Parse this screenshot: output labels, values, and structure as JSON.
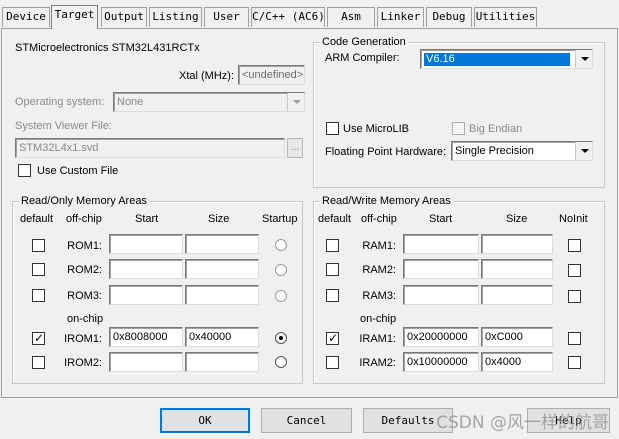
{
  "tabs": [
    {
      "label": "Device",
      "active": false
    },
    {
      "label": "Target",
      "active": true
    },
    {
      "label": "Output",
      "active": false
    },
    {
      "label": "Listing",
      "active": false
    },
    {
      "label": "User",
      "active": false
    },
    {
      "label": "C/C++ (AC6)",
      "active": false
    },
    {
      "label": "Asm",
      "active": false
    },
    {
      "label": "Linker",
      "active": false
    },
    {
      "label": "Debug",
      "active": false
    },
    {
      "label": "Utilities",
      "active": false
    }
  ],
  "device": {
    "name": "STMicroelectronics STM32L431RCTx",
    "xtal_label": "Xtal (MHz):",
    "xtal_value": "<undefined>",
    "os_label": "Operating system:",
    "os_value": "None",
    "svd_label": "System Viewer File:",
    "svd_value": "STM32L4x1.svd",
    "browse_label": "...",
    "custom_file_label": "Use Custom File",
    "custom_file_checked": false
  },
  "codegen": {
    "title": "Code Generation",
    "compiler_label": "ARM Compiler:",
    "compiler_value": "V6.16",
    "microlib_label": "Use MicroLIB",
    "microlib_checked": false,
    "big_endian_label": "Big Endian",
    "big_endian_checked": false,
    "fph_label": "Floating Point Hardware:",
    "fph_value": "Single Precision"
  },
  "ro_memory": {
    "title": "Read/Only Memory Areas",
    "headers": {
      "default": "default",
      "offchip": "off-chip",
      "start": "Start",
      "size": "Size",
      "startup": "Startup"
    },
    "onchip_label": "on-chip",
    "rows": [
      {
        "name": "ROM1:",
        "default": false,
        "start": "",
        "size": "",
        "startup": false,
        "enabled": false
      },
      {
        "name": "ROM2:",
        "default": false,
        "start": "",
        "size": "",
        "startup": false,
        "enabled": false
      },
      {
        "name": "ROM3:",
        "default": false,
        "start": "",
        "size": "",
        "startup": false,
        "enabled": false
      },
      {
        "name": "IROM1:",
        "default": true,
        "start": "0x8008000",
        "size": "0x40000",
        "startup": true,
        "enabled": true
      },
      {
        "name": "IROM2:",
        "default": false,
        "start": "",
        "size": "",
        "startup": false,
        "enabled": true
      }
    ]
  },
  "rw_memory": {
    "title": "Read/Write Memory Areas",
    "headers": {
      "default": "default",
      "offchip": "off-chip",
      "start": "Start",
      "size": "Size",
      "noinit": "NoInit"
    },
    "onchip_label": "on-chip",
    "rows": [
      {
        "name": "RAM1:",
        "default": false,
        "start": "",
        "size": "",
        "noinit": false
      },
      {
        "name": "RAM2:",
        "default": false,
        "start": "",
        "size": "",
        "noinit": false
      },
      {
        "name": "RAM3:",
        "default": false,
        "start": "",
        "size": "",
        "noinit": false
      },
      {
        "name": "IRAM1:",
        "default": true,
        "start": "0x20000000",
        "size": "0xC000",
        "noinit": false
      },
      {
        "name": "IRAM2:",
        "default": false,
        "start": "0x10000000",
        "size": "0x4000",
        "noinit": false
      }
    ]
  },
  "buttons": {
    "ok": "OK",
    "cancel": "Cancel",
    "defaults": "Defaults",
    "help": "Help"
  },
  "watermark": "CSDN @风一样的航哥",
  "colors": {
    "selection": "#0078d7",
    "background": "#f0f0f0"
  }
}
